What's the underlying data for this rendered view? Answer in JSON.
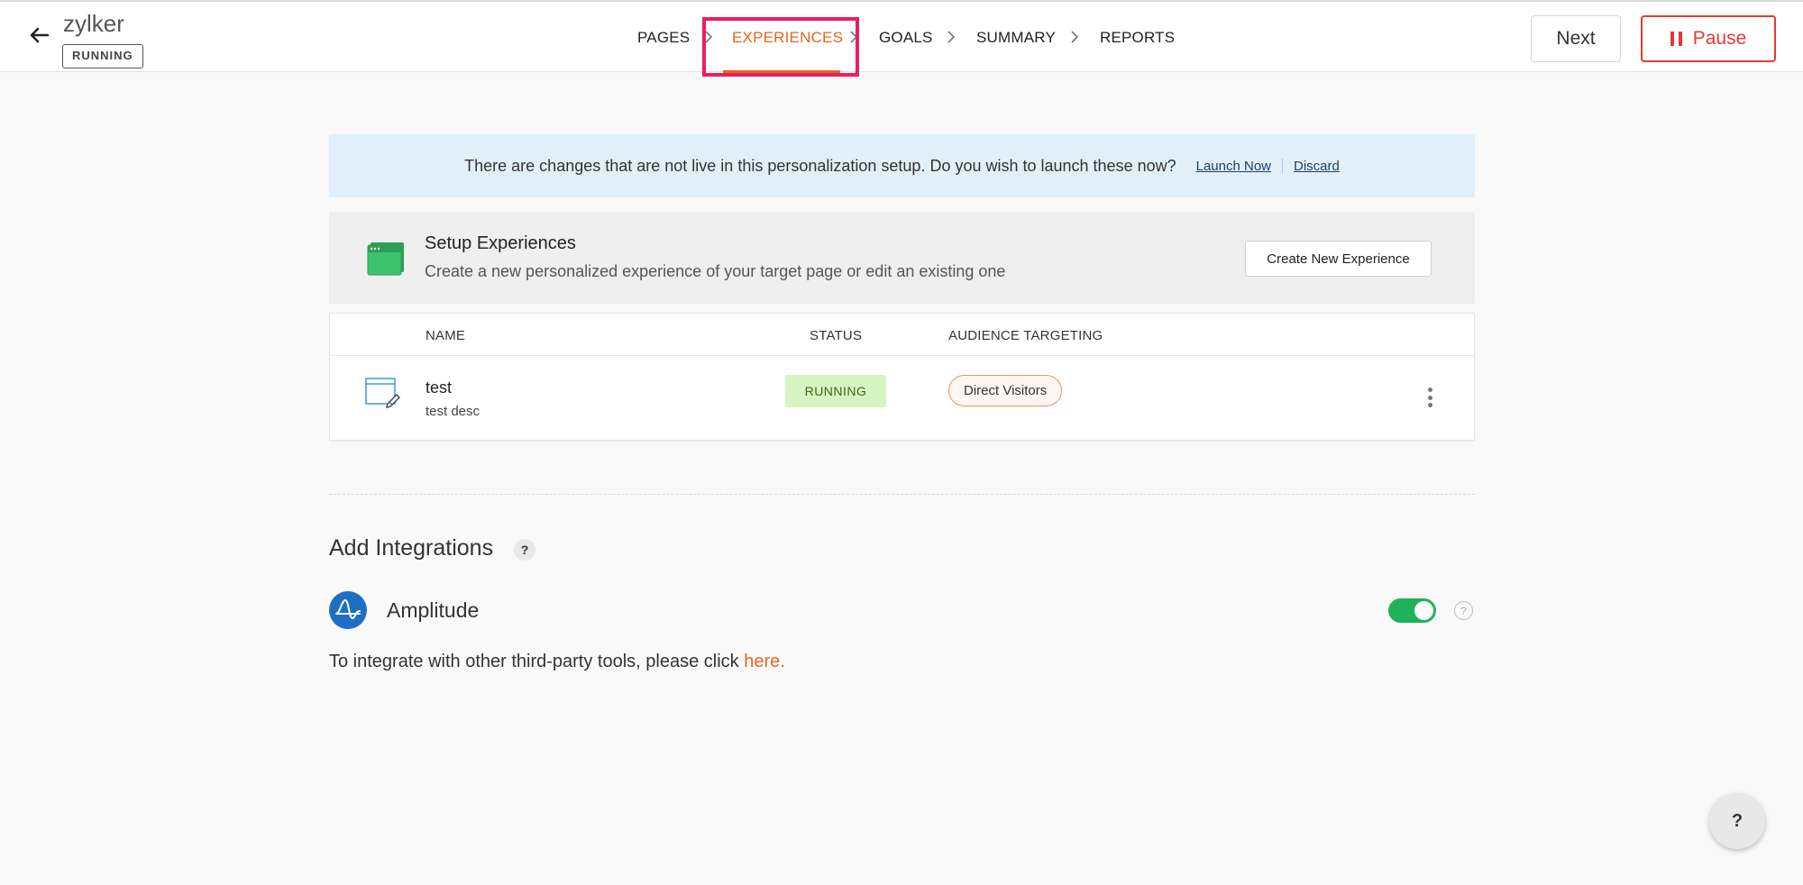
{
  "header": {
    "app_name": "zylker",
    "status": "RUNNING",
    "steps": [
      {
        "label": "PAGES"
      },
      {
        "label": "EXPERIENCES"
      },
      {
        "label": "GOALS"
      },
      {
        "label": "SUMMARY"
      },
      {
        "label": "REPORTS"
      }
    ],
    "active_step": "EXPERIENCES",
    "next_label": "Next",
    "pause_label": "Pause"
  },
  "banner": {
    "message": "There are changes that are not live in this personalization setup. Do you wish to launch these now?",
    "launch_label": "Launch Now",
    "discard_label": "Discard"
  },
  "setup": {
    "title": "Setup Experiences",
    "description": "Create a new personalized experience of your target page or edit an existing one",
    "create_label": "Create New Experience"
  },
  "table": {
    "headers": {
      "name": "NAME",
      "status": "STATUS",
      "audience": "AUDIENCE TARGETING"
    },
    "rows": [
      {
        "name": "test",
        "description": "test desc",
        "status": "RUNNING",
        "audience": "Direct Visitors"
      }
    ]
  },
  "integrations": {
    "title": "Add Integrations",
    "help": "?",
    "items": [
      {
        "name": "Amplitude",
        "enabled": true
      }
    ],
    "note_prefix": "To integrate with other third-party tools, please click ",
    "note_link": "here."
  },
  "help_fab": "?",
  "colors": {
    "accent": "#e8641b",
    "pause": "#e53935",
    "highlight": "#e91e63",
    "toggle_on": "#1fb25a",
    "running_bg": "#d6f5c2"
  }
}
